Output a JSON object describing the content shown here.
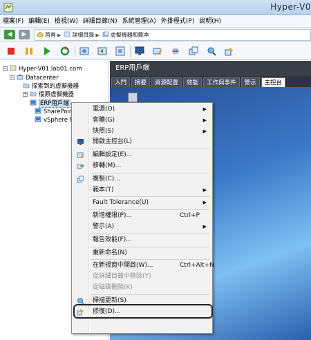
{
  "window": {
    "title": "Hyper-V0"
  },
  "menubar": [
    "檔案(F)",
    "編輯(E)",
    "檢視(W)",
    "詳細目錄(N)",
    "系統管理(A)",
    "外掛程式(P)",
    "說明(H)"
  ],
  "address": {
    "crumbs": [
      "首頁",
      "詳細目錄",
      "虛擬機器和範本"
    ]
  },
  "tree": {
    "root": "Hyper-V01.lab01.com",
    "datacenter": "Datacenter",
    "children": [
      "探索到的虛擬機器",
      "復原虛擬機器",
      "ERP用戶端",
      "SharePoint",
      "vSphere R"
    ]
  },
  "right_panel": {
    "title": "ERP用戶端",
    "tabs": [
      "入門",
      "摘要",
      "資源配置",
      "效能",
      "工作與事件",
      "警示",
      "主控台"
    ],
    "active_tab": "主控台"
  },
  "context_menu": {
    "items": [
      {
        "label": "電源(O)",
        "submenu": true,
        "icon": "",
        "disabled": false
      },
      {
        "label": "客體(G)",
        "submenu": true,
        "icon": "",
        "disabled": false
      },
      {
        "label": "快照(S)",
        "submenu": true,
        "icon": "",
        "disabled": false
      },
      {
        "label": "開啟主控台(L)",
        "submenu": false,
        "icon": "console-icon",
        "disabled": false
      },
      {
        "sep": true
      },
      {
        "label": "編輯設定(E)...",
        "submenu": false,
        "icon": "edit-settings-icon",
        "disabled": false
      },
      {
        "label": "移轉(M)...",
        "submenu": false,
        "icon": "migrate-icon",
        "disabled": false
      },
      {
        "sep": true
      },
      {
        "label": "複製(C)...",
        "submenu": false,
        "icon": "clone-icon",
        "disabled": false
      },
      {
        "label": "範本(T)",
        "submenu": true,
        "icon": "",
        "disabled": false
      },
      {
        "sep": true
      },
      {
        "label": "Fault Tolerance(U)",
        "submenu": true,
        "icon": "",
        "disabled": false
      },
      {
        "sep": true
      },
      {
        "label": "新增權限(P)...",
        "shortcut": "Ctrl+P",
        "submenu": false,
        "icon": "",
        "disabled": false
      },
      {
        "label": "警示(A)",
        "submenu": true,
        "icon": "",
        "disabled": false
      },
      {
        "sep": true
      },
      {
        "label": "報告效能(F)...",
        "submenu": false,
        "icon": "",
        "disabled": false
      },
      {
        "sep": true
      },
      {
        "label": "重新命名(N)",
        "submenu": false,
        "icon": "",
        "disabled": false
      },
      {
        "sep": true
      },
      {
        "label": "在新視窗中開啟(W)...",
        "shortcut": "Ctrl+Alt+N",
        "submenu": false,
        "icon": "",
        "disabled": false
      },
      {
        "label": "從詳細目錄中移除(Y)",
        "submenu": false,
        "icon": "",
        "disabled": true
      },
      {
        "label": "從磁碟刪除(K)",
        "submenu": false,
        "icon": "",
        "disabled": true
      },
      {
        "sep": true
      },
      {
        "label": "掃描更新(S)",
        "submenu": false,
        "icon": "scan-updates-icon",
        "disabled": false
      },
      {
        "label": "修復(D)...",
        "submenu": false,
        "icon": "remediate-icon",
        "disabled": false
      }
    ]
  }
}
